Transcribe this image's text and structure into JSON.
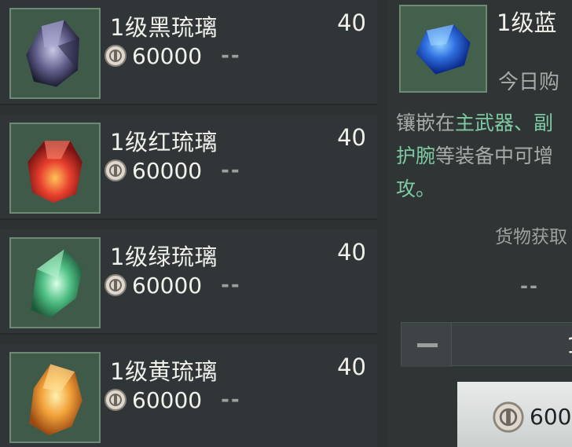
{
  "items": [
    {
      "name": "1级黑琉璃",
      "count": "40",
      "price": "60000",
      "status": "--",
      "gem_color": "black",
      "icon": "black-gem-icon"
    },
    {
      "name": "1级红琉璃",
      "count": "40",
      "price": "60000",
      "status": "--",
      "gem_color": "red",
      "icon": "red-gem-icon"
    },
    {
      "name": "1级绿琉璃",
      "count": "40",
      "price": "60000",
      "status": "--",
      "gem_color": "green",
      "icon": "green-gem-icon"
    },
    {
      "name": "1级黄琉璃",
      "count": "40",
      "price": "60000",
      "status": "--",
      "gem_color": "yellow",
      "icon": "yellow-gem-icon"
    }
  ],
  "detail": {
    "name": "1级蓝",
    "today_label": "今日购",
    "desc_line1_a": "镶嵌在",
    "desc_line1_b": "主武器、副",
    "desc_line2_a": "护腕",
    "desc_line2_b": "等装备中可增",
    "desc_line3": "攻。",
    "source_label": "货物获取",
    "source_value": "--",
    "quantity": "1",
    "buy_price": "600",
    "icon": "blue-gem-icon"
  },
  "colors": {
    "highlight": "#7fc9a2",
    "background": "#2d3132",
    "card": "#303638",
    "thumb_bg": "#3f5a48"
  }
}
